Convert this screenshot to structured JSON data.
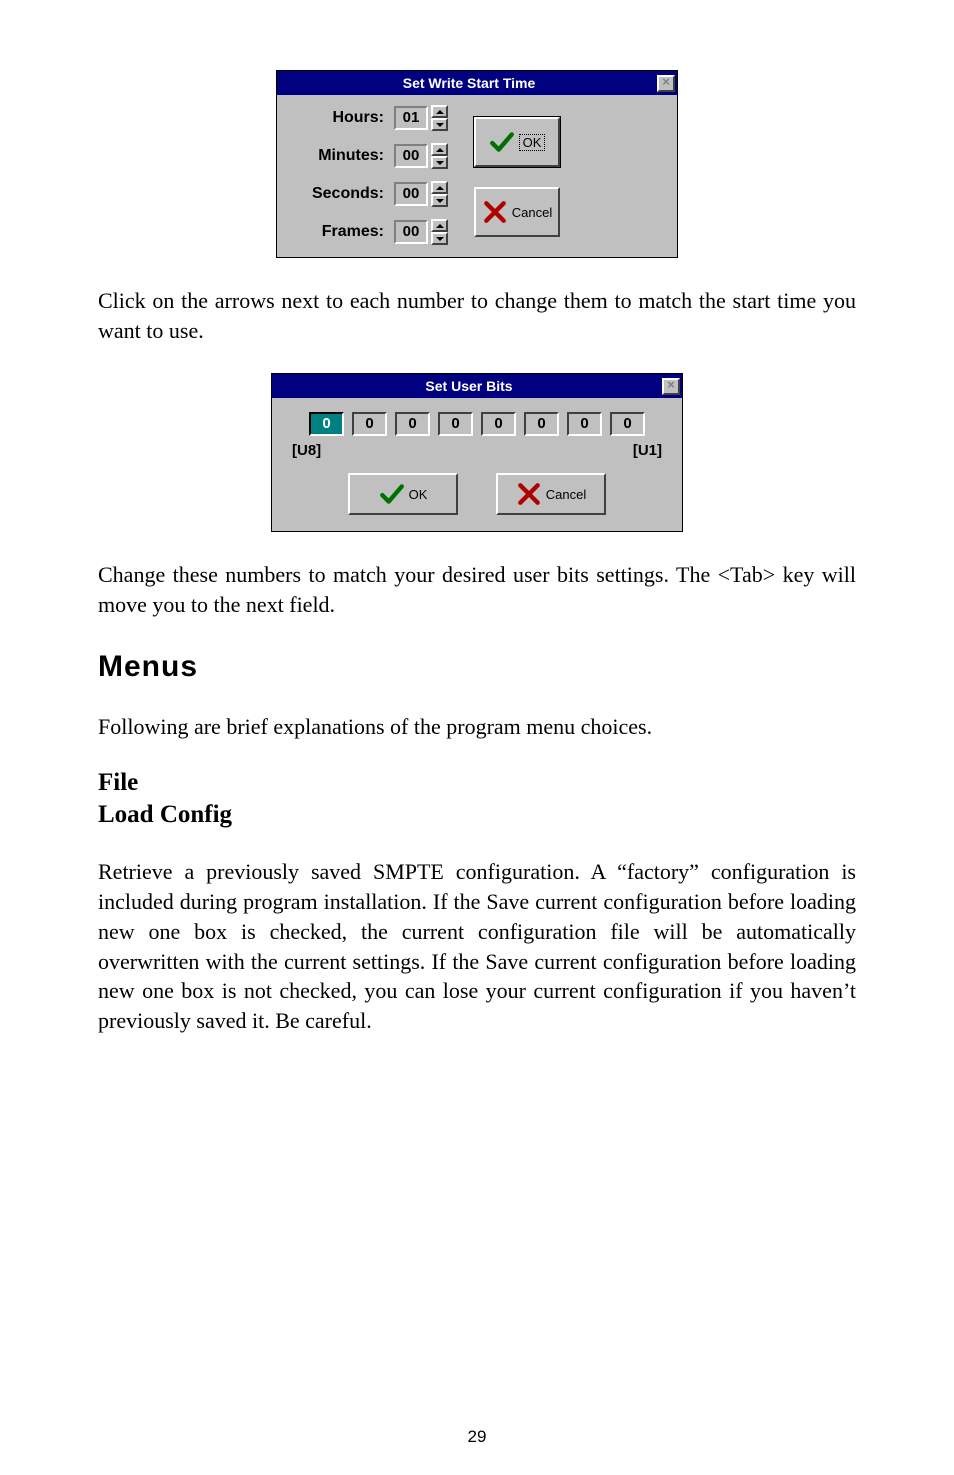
{
  "dialog1": {
    "title": "Set Write Start Time",
    "close_glyph": "×",
    "rows": {
      "hours": {
        "label": "Hours:",
        "value": "01"
      },
      "minutes": {
        "label": "Minutes:",
        "value": "00"
      },
      "seconds": {
        "label": "Seconds:",
        "value": "00"
      },
      "frames": {
        "label": "Frames:",
        "value": "00"
      }
    },
    "ok_label": "OK",
    "cancel_label": "Cancel"
  },
  "para1": "Click on the arrows next to each number to change them to match the start time you want to use.",
  "dialog2": {
    "title": "Set User Bits",
    "close_glyph": "×",
    "bits": [
      "0",
      "0",
      "0",
      "0",
      "0",
      "0",
      "0",
      "0"
    ],
    "u8_label": "[U8]",
    "u1_label": "[U1]",
    "ok_label": "OK",
    "cancel_label": "Cancel"
  },
  "para2": "Change these numbers to match your desired user bits settings. The <Tab> key will move you to the next field.",
  "menus_heading": "Menus",
  "para3": "Following are brief explanations of the program menu choices.",
  "file_heading": "File",
  "load_config_heading": "Load Config",
  "para4": "Retrieve a previously saved SMPTE configuration.  A “factory” configuration is included during program installation.  If the Save current configuration before loading new one box is checked, the current configuration file will be automatically overwritten with the current settings.  If the Save current configuration before loading new one box is not checked, you can lose your current configuration if you haven’t previously saved it.  Be careful.",
  "page_number": "29"
}
